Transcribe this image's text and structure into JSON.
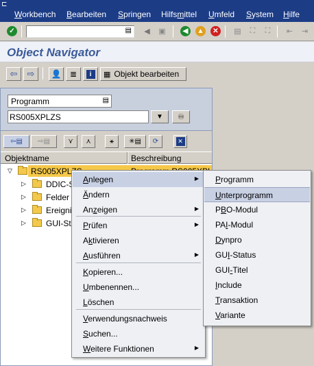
{
  "menubar": {
    "items": [
      {
        "accel": "W",
        "rest": "orkbench"
      },
      {
        "accel": "B",
        "rest": "earbeiten"
      },
      {
        "accel": "S",
        "rest": "pringen"
      },
      {
        "pre": "Hilfs",
        "accel": "m",
        "rest": "ittel"
      },
      {
        "accel": "U",
        "rest": "mfeld"
      },
      {
        "accel": "S",
        "rest": "ystem"
      },
      {
        "accel": "H",
        "rest": "ilfe"
      }
    ]
  },
  "toolbar": {
    "command_value": "",
    "icons": [
      "enter-icon",
      "history-dropdown-icon",
      "back-triangle-icon",
      "save-icon",
      "back-icon",
      "exit-icon",
      "cancel-icon",
      "print-icon",
      "find-icon",
      "find-next-icon",
      "first-page-icon",
      "last-page-icon"
    ]
  },
  "title": "Object Navigator",
  "app_toolbar": {
    "object_edit_label": "Objekt bearbeiten"
  },
  "navigator": {
    "object_type": "Programm",
    "object_name": "RS005XPLZS",
    "columns": {
      "name": "Objektname",
      "description": "Beschreibung"
    },
    "tree": {
      "root": {
        "label": "RS005XPLZS",
        "description": "Programm RS005XPLZS"
      },
      "children": [
        "DDIC-Strukturen",
        "Felder",
        "Ereignisse",
        "GUI-Status"
      ]
    }
  },
  "context_menu": {
    "groups": [
      [
        {
          "label": "Anlegen",
          "accel_index": 0,
          "has_submenu": true,
          "highlighted": true
        },
        {
          "label": "Ändern",
          "accel_index": 0,
          "has_submenu": false
        },
        {
          "label": "Anzeigen",
          "accel_index": 2,
          "has_submenu": true
        }
      ],
      [
        {
          "label": "Prüfen",
          "accel_index": 0,
          "has_submenu": true
        },
        {
          "label": "Aktivieren",
          "accel_index": 1,
          "has_submenu": false
        },
        {
          "label": "Ausführen",
          "accel_index": 0,
          "has_submenu": true
        }
      ],
      [
        {
          "label": "Kopieren...",
          "accel_index": 0,
          "has_submenu": false
        },
        {
          "label": "Umbenennen...",
          "accel_index": 0,
          "has_submenu": false
        },
        {
          "label": "Löschen",
          "accel_index": 0,
          "has_submenu": false
        }
      ],
      [
        {
          "label": "Verwendungsnachweis",
          "accel_index": 0,
          "has_submenu": false
        },
        {
          "label": "Suchen...",
          "accel_index": 0,
          "has_submenu": false
        },
        {
          "label": "Weitere Funktionen",
          "accel_index": 0,
          "has_submenu": true
        }
      ]
    ]
  },
  "submenu": {
    "items": [
      {
        "label": "Programm",
        "accel_index": 0,
        "highlighted": false
      },
      {
        "label": "Unterprogramm",
        "accel_index": 0,
        "highlighted": true
      },
      {
        "label": "PBO-Modul",
        "accel_index": 1,
        "highlighted": false
      },
      {
        "label": "PAI-Modul",
        "accel_index": 2,
        "highlighted": false
      },
      {
        "label": "Dynpro",
        "accel_index": 0,
        "highlighted": false
      },
      {
        "label": "GUI-Status",
        "accel_index": 2,
        "highlighted": false
      },
      {
        "label": "GUI-Titel",
        "accel_index": 3,
        "highlighted": false
      },
      {
        "label": "Include",
        "accel_index": 0,
        "highlighted": false
      },
      {
        "label": "Transaktion",
        "accel_index": 0,
        "highlighted": false
      },
      {
        "label": "Variante",
        "accel_index": 0,
        "highlighted": false
      }
    ]
  }
}
